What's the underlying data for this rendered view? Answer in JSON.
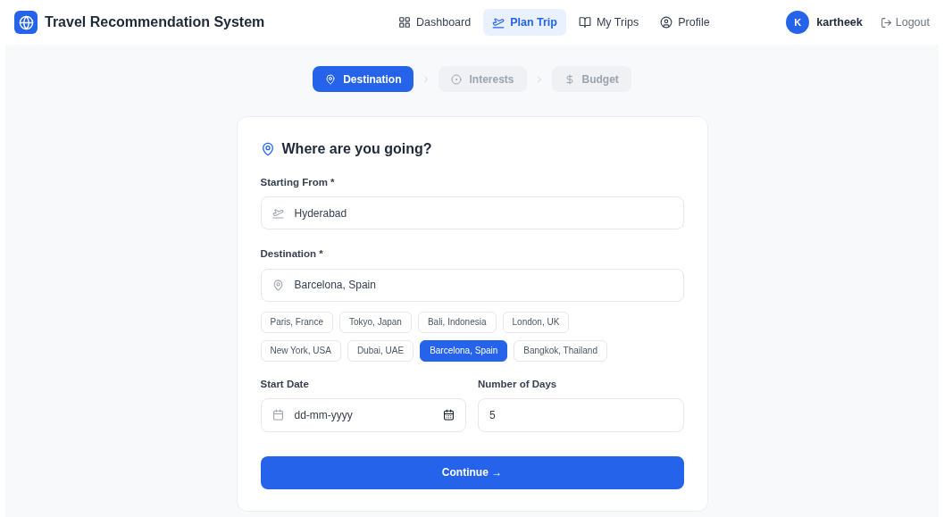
{
  "header": {
    "title": "Travel Recommendation System",
    "nav": [
      {
        "label": "Dashboard",
        "kind": "grid",
        "selected": false
      },
      {
        "label": "Plan Trip",
        "kind": "plane",
        "selected": true
      },
      {
        "label": "My Trips",
        "kind": "book",
        "selected": false
      },
      {
        "label": "Profile",
        "kind": "user",
        "selected": false
      }
    ],
    "user": {
      "initial": "K",
      "name": "kartheek"
    },
    "logout": "Logout"
  },
  "steps": [
    {
      "label": "Destination",
      "kind": "pin",
      "selected": true
    },
    {
      "label": "Interests",
      "kind": "dot",
      "selected": false
    },
    {
      "label": "Budget",
      "kind": "dollar",
      "selected": false
    }
  ],
  "form": {
    "title": "Where are you going?",
    "from": {
      "label": "Starting From *",
      "value": "Hyderabad"
    },
    "destination": {
      "label": "Destination *",
      "value": "Barcelona, Spain"
    },
    "suggestions": [
      {
        "label": "Paris, France",
        "selected": false
      },
      {
        "label": "Tokyo, Japan",
        "selected": false
      },
      {
        "label": "Bali, Indonesia",
        "selected": false
      },
      {
        "label": "London, UK",
        "selected": false
      },
      {
        "label": "New York, USA",
        "selected": false
      },
      {
        "label": "Dubai, UAE",
        "selected": false
      },
      {
        "label": "Barcelona, Spain",
        "selected": true
      },
      {
        "label": "Bangkok, Thailand",
        "selected": false
      }
    ],
    "start_date": {
      "label": "Start Date",
      "placeholder": "dd-mm-yyyy"
    },
    "days": {
      "label": "Number of Days",
      "value": "5"
    },
    "submit": "Continue →"
  }
}
